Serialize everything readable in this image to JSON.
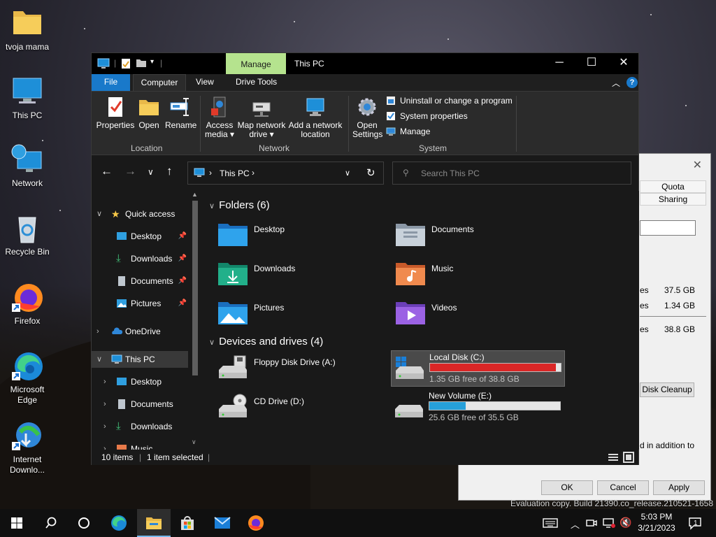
{
  "desktop": {
    "icons": [
      {
        "label": "tvoja mama",
        "icon": "folder-icon"
      },
      {
        "label": "This PC",
        "icon": "monitor-icon"
      },
      {
        "label": "Network",
        "icon": "network-icon"
      },
      {
        "label": "Recycle Bin",
        "icon": "recycle-bin-icon"
      },
      {
        "label": "Firefox",
        "icon": "firefox-icon"
      },
      {
        "label": "Microsoft Edge",
        "icon": "edge-icon"
      },
      {
        "label": "Internet Downlo...",
        "icon": "idm-icon"
      }
    ]
  },
  "back_dialog": {
    "tabs": [
      "Quota",
      "Sharing"
    ],
    "rows": [
      {
        "label": "es",
        "value": "37.5 GB"
      },
      {
        "label": "es",
        "value": "1.34 GB"
      },
      {
        "label": "es",
        "value": "38.8 GB"
      }
    ],
    "disk_cleanup": "Disk Cleanup",
    "note": "d in addition to",
    "ok": "OK",
    "cancel": "Cancel",
    "apply": "Apply"
  },
  "explorer": {
    "title": "This PC",
    "manage_tab": "Manage",
    "ribbon_tabs": {
      "file": "File",
      "computer": "Computer",
      "view": "View",
      "drive_tools": "Drive Tools"
    },
    "ribbon": {
      "location": {
        "label": "Location",
        "properties": "Properties",
        "open": "Open",
        "rename": "Rename"
      },
      "network": {
        "label": "Network",
        "access_media": "Access media",
        "map_drive": "Map network drive",
        "add_location": "Add a network location"
      },
      "system": {
        "label": "System",
        "open_settings": "Open Settings",
        "uninstall": "Uninstall or change a program",
        "system_properties": "System properties",
        "manage": "Manage"
      }
    },
    "address": {
      "path": "This PC"
    },
    "search": {
      "placeholder": "Search This PC"
    },
    "nav": {
      "quick_access": "Quick access",
      "qa_items": [
        "Desktop",
        "Downloads",
        "Documents",
        "Pictures"
      ],
      "onedrive": "OneDrive",
      "this_pc": "This PC",
      "pc_items": [
        "Desktop",
        "Documents",
        "Downloads",
        "Music"
      ]
    },
    "folders": {
      "header": "Folders (6)",
      "items": [
        "Desktop",
        "Documents",
        "Downloads",
        "Music",
        "Pictures",
        "Videos"
      ]
    },
    "drives": {
      "header": "Devices and drives (4)",
      "floppy": "Floppy Disk Drive (A:)",
      "local": {
        "name": "Local Disk (C:)",
        "free": "1.35 GB free of 38.8 GB",
        "used_fraction": 0.965,
        "color": "#da2626"
      },
      "cd": "CD Drive (D:)",
      "volume": {
        "name": "New Volume (E:)",
        "free": "25.6 GB free of 35.5 GB",
        "used_fraction": 0.279,
        "color": "#26a0da"
      }
    },
    "status": {
      "count": "10 items",
      "selected": "1 item selected"
    }
  },
  "watermark": "Evaluation copy. Build 21390.co_release.210521-1658",
  "taskbar": {
    "time": "5:03 PM",
    "date": "3/21/2023",
    "notifications": "1"
  }
}
